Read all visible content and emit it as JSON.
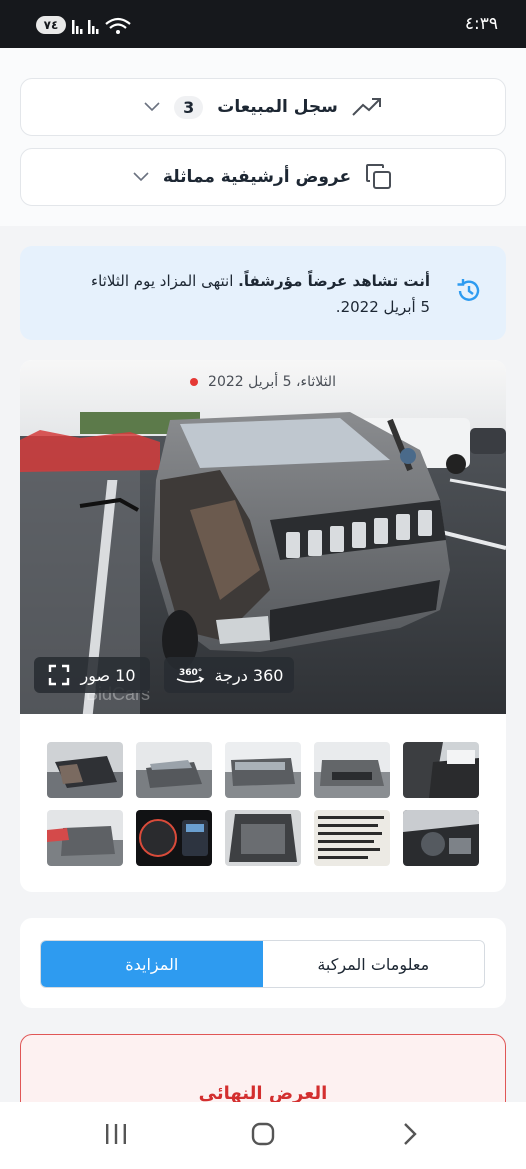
{
  "status_bar": {
    "time": "٤:٣٩",
    "battery": "٧٤"
  },
  "sales_history": {
    "title": "سجل المبيعات",
    "count": "3",
    "icon": "trend-up-icon"
  },
  "similar_archived": {
    "title": "عروض أرشيفية مماثلة",
    "icon": "copy-icon"
  },
  "notice": {
    "bold": "أنت تشاهد عرضاً مؤرشفاً.",
    "text": "انتهى المزاد يوم الثلاثاء 5 أبريل 2022."
  },
  "gallery": {
    "date": "الثلاثاء، 5 أبريل 2022",
    "photos_label": "10 صور",
    "view360_label": "360 درجة"
  },
  "tabs": {
    "vehicle_info": "معلومات المركبة",
    "auction": "المزايدة"
  },
  "final_bid": {
    "title": "العرض النهائي"
  },
  "colors": {
    "accent": "#2e9bf0",
    "notice_bg": "#e6f1fc",
    "alert": "#d32f2f"
  }
}
